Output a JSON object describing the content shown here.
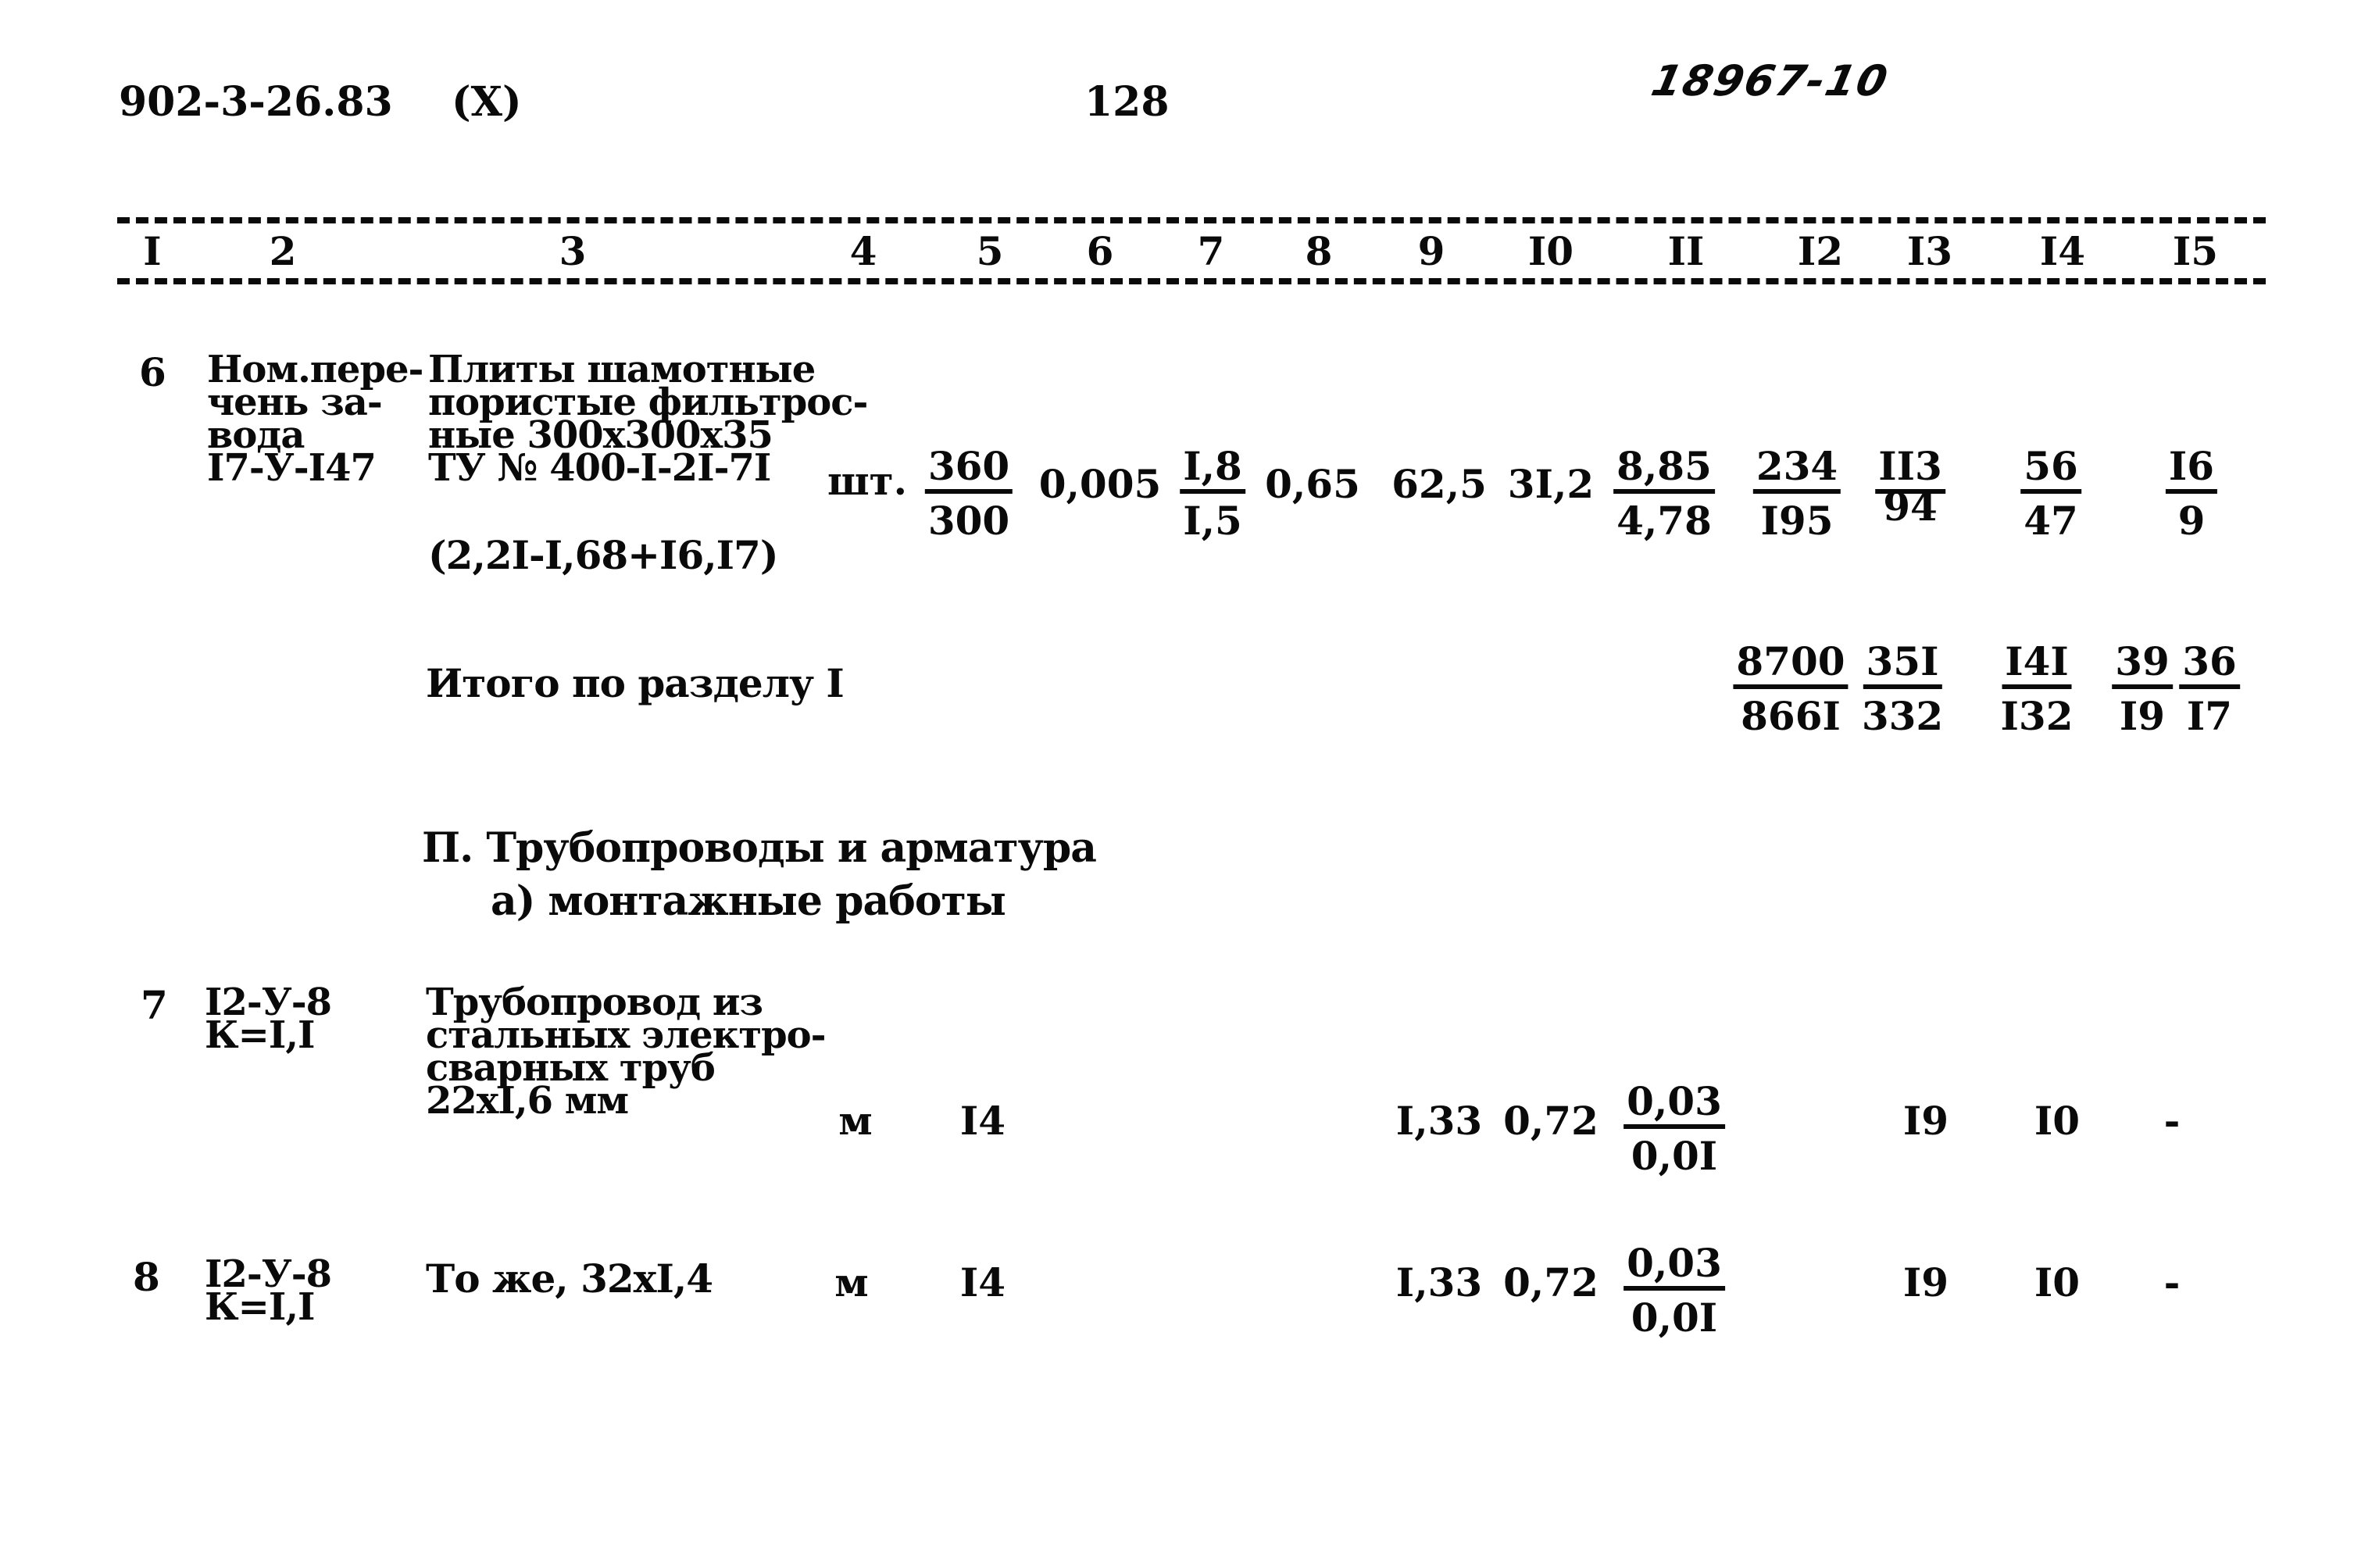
{
  "header": {
    "doc_code": "902-3-26.83",
    "marker": "(X)",
    "page_number": "128",
    "stamp": "18967-10"
  },
  "columns": [
    "I",
    "2",
    "3",
    "4",
    "5",
    "6",
    "7",
    "8",
    "9",
    "I0",
    "II",
    "I2",
    "I3",
    "I4",
    "I5"
  ],
  "rows": {
    "r6": {
      "num": "6",
      "basis": [
        "Ном.пере-",
        "чень за-",
        "вода",
        "I7-У-I47"
      ],
      "name": [
        "Плиты шамотные",
        "пористые фильтроc-",
        "ные 300x300x35",
        "ТУ № 400-I-2I-7I"
      ],
      "formula": "(2,2I-I,68+I6,I7)",
      "unit": "шт.",
      "c5": {
        "num": "360",
        "den": "300"
      },
      "c6": "0,005",
      "c7": {
        "num": "I,8",
        "den": "I,5"
      },
      "c8": "0,65",
      "c9": "62,5",
      "c10": "3I,2",
      "c11": {
        "num": "8,85",
        "den": "4,78"
      },
      "c12": {
        "num": "234",
        "den": "I95"
      },
      "c13": {
        "num": "II3",
        "den": "94"
      },
      "c14": {
        "num": "56",
        "den": "47"
      },
      "c15": {
        "num": "I6",
        "den": "9"
      }
    },
    "total1": {
      "label": "Итого по разделу I",
      "c12": {
        "num": "8700",
        "den": "866I"
      },
      "c13": {
        "num": "35I",
        "den": "332"
      },
      "c14": {
        "num": "I4I",
        "den": "I32"
      },
      "c15a": {
        "num": "39",
        "den": "I9"
      },
      "c15b": {
        "num": "36",
        "den": "I7"
      }
    },
    "section2": {
      "title": "П. Трубопроводы и арматура",
      "subtitle": "а) монтажные работы"
    },
    "r7": {
      "num": "7",
      "basis": [
        "I2-У-8",
        "К=I,I"
      ],
      "name": [
        "Трубопровод из",
        "стальных электро-",
        "сварных труб",
        "22xI,6 мм"
      ],
      "unit": "м",
      "c5": "I4",
      "c9": "I,33",
      "c10": "0,72",
      "c11": {
        "num": "0,03",
        "den": "0,0I"
      },
      "c13": "I9",
      "c14": "I0",
      "c15": "-"
    },
    "r8": {
      "num": "8",
      "basis": [
        "I2-У-8",
        "К=I,I"
      ],
      "name": "То же, 32xI,4",
      "unit": "м",
      "c5": "I4",
      "c9": "I,33",
      "c10": "0,72",
      "c11": {
        "num": "0,03",
        "den": "0,0I"
      },
      "c13": "I9",
      "c14": "I0",
      "c15": "-"
    }
  }
}
